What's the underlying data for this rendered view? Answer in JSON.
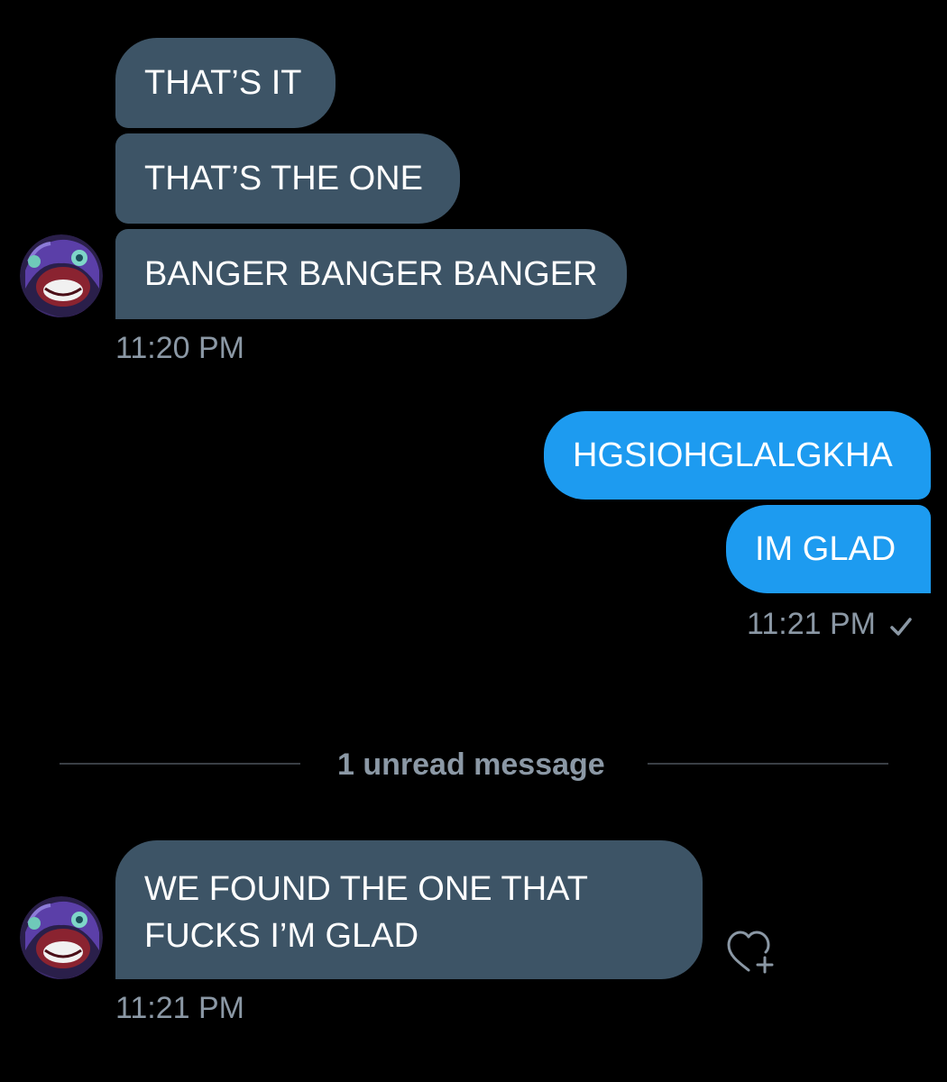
{
  "thread": {
    "group1": {
      "messages": [
        "THAT’S IT",
        "THAT’S THE ONE",
        "BANGER BANGER BANGER"
      ],
      "time": "11:20 PM"
    },
    "group2": {
      "messages": [
        "HGSIOHGLALGKHA",
        "IM GLAD"
      ],
      "time": "11:21 PM",
      "status_icon": "check-icon"
    },
    "unread_divider": "1 unread message",
    "group3": {
      "message_line1": "WE FOUND THE ONE THAT",
      "message_line2": "FUCKS I’M GLAD",
      "time": "11:21 PM",
      "reaction_icon": "heart-plus-icon"
    }
  },
  "colors": {
    "background": "#000000",
    "incoming_bubble": "#3d5466",
    "outgoing_bubble": "#1d9bf0",
    "timestamp": "#8b98a5"
  }
}
